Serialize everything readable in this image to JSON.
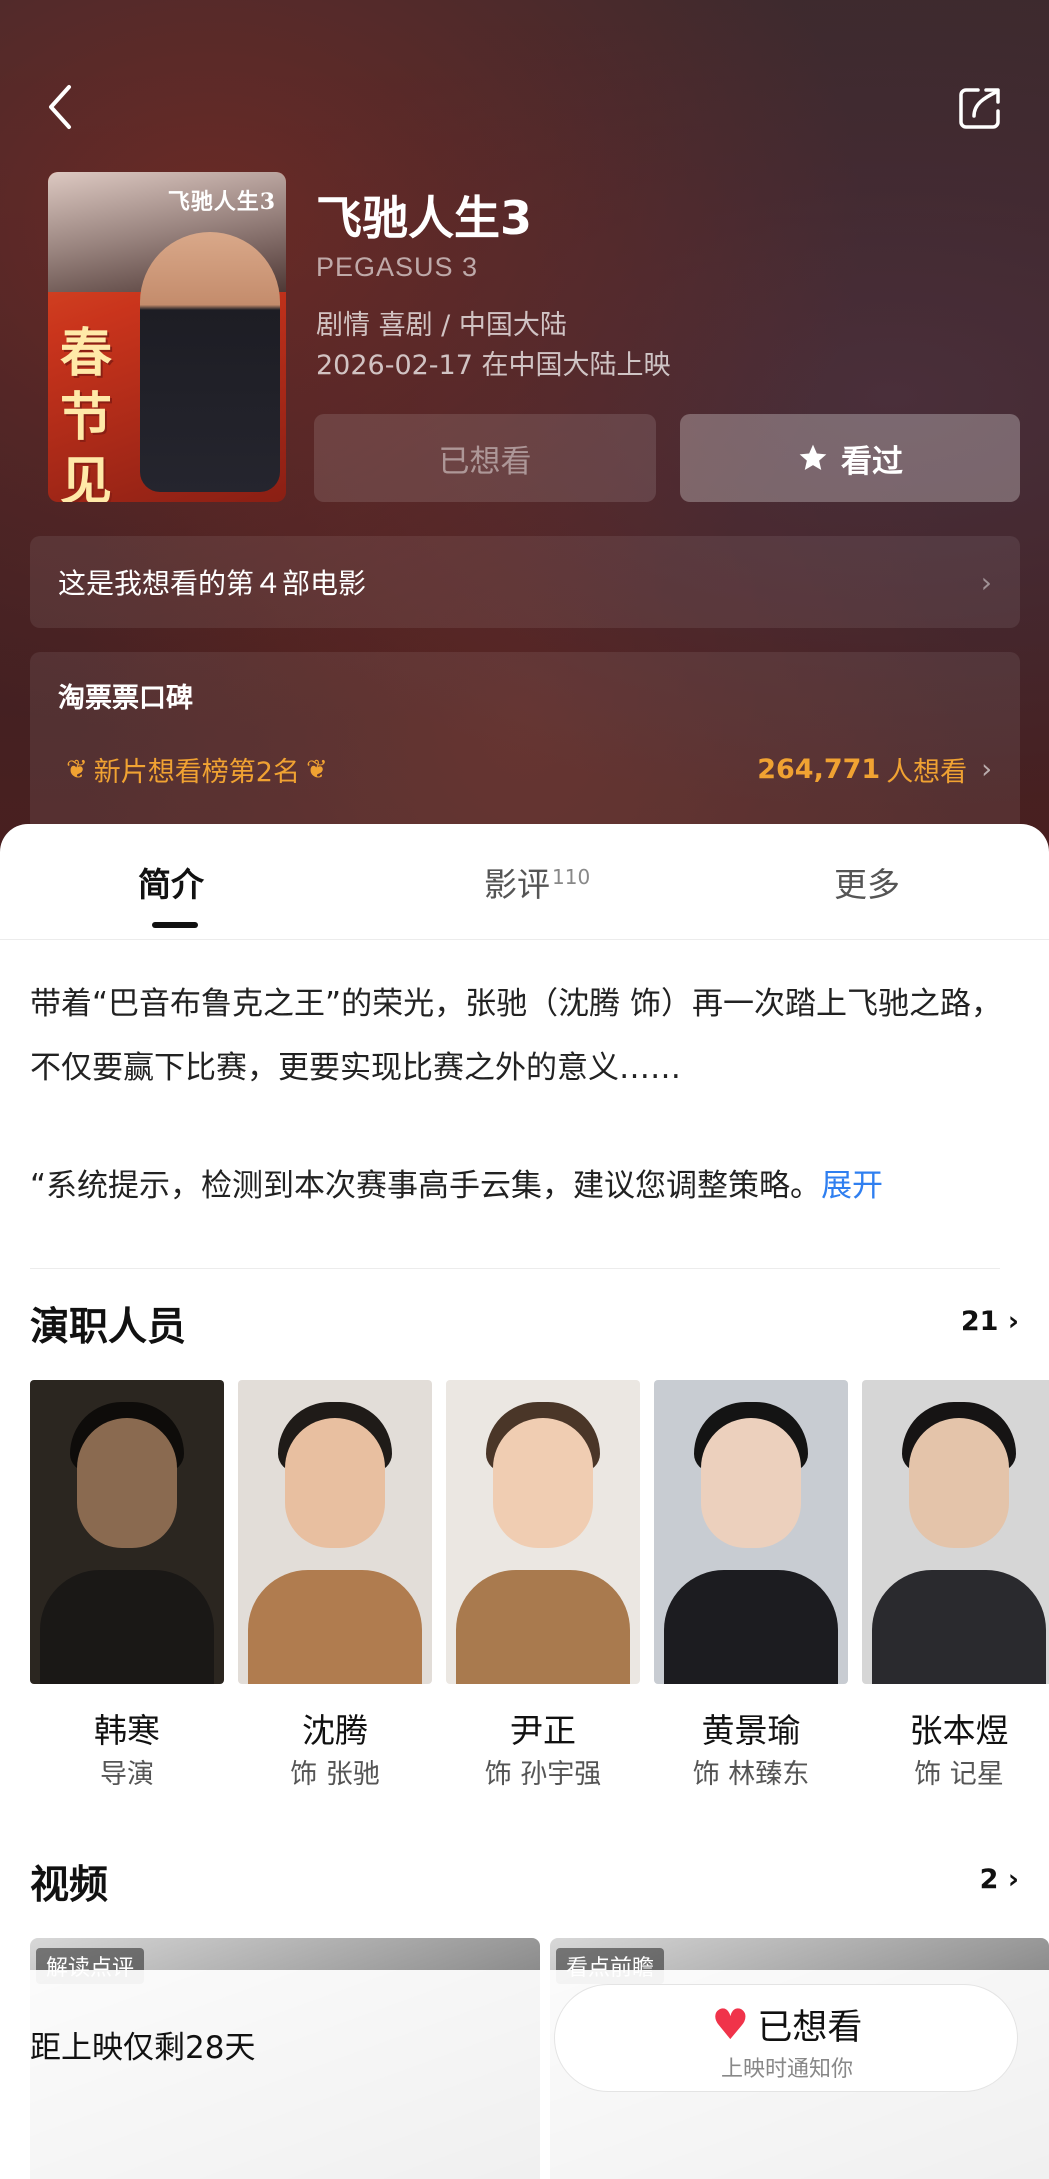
{
  "header": {
    "movie_title": "飞驰人生3",
    "english_title": "PEGASUS 3",
    "genres_region": "剧情 喜剧 / 中国大陆",
    "release": "2026-02-17 在中国大陆上映",
    "poster": {
      "title": "飞驰人生3",
      "slogan": "春节见"
    },
    "want_button": "已想看",
    "seen_button": "看过",
    "want_count_text": "这是我想看的第４部电影"
  },
  "koubei": {
    "title": "淘票票口碑",
    "rank": "新片想看榜第2名",
    "wants_number": "264,771",
    "wants_suffix": "人想看"
  },
  "tabs": [
    {
      "label": "简介",
      "active": true
    },
    {
      "label": "影评",
      "count": "110"
    },
    {
      "label": "更多"
    }
  ],
  "synopsis": {
    "text": "带着“巴音布鲁克之王”的荣光，张驰（沈腾 饰）再一次踏上飞驰之路，不仅要赢下比赛，更要实现比赛之外的意义……",
    "quote": "“系统提示，检测到本次赛事高手云集，建议您调整策略。",
    "expand": "展开"
  },
  "cast": {
    "title": "演职人员",
    "count": "21",
    "members": [
      {
        "name": "韩寒",
        "role": "导演"
      },
      {
        "name": "沈腾",
        "role": "饰 张驰"
      },
      {
        "name": "尹正",
        "role": "饰 孙宇强"
      },
      {
        "name": "黄景瑜",
        "role": "饰 林臻东"
      },
      {
        "name": "张本煜",
        "role": "饰 记星"
      }
    ]
  },
  "videos": {
    "title": "视频",
    "count": "2",
    "items": [
      {
        "tag": "解读点评"
      },
      {
        "tag": "看点前瞻"
      }
    ]
  },
  "bottom_bar": {
    "countdown": "距上映仅剩28天",
    "wanted_label": "已想看",
    "wanted_sub": "上映时通知你"
  },
  "colors": {
    "accent_orange": "#f0a232",
    "expand_blue": "#2f7ff0",
    "heart_red": "#f0334a"
  }
}
